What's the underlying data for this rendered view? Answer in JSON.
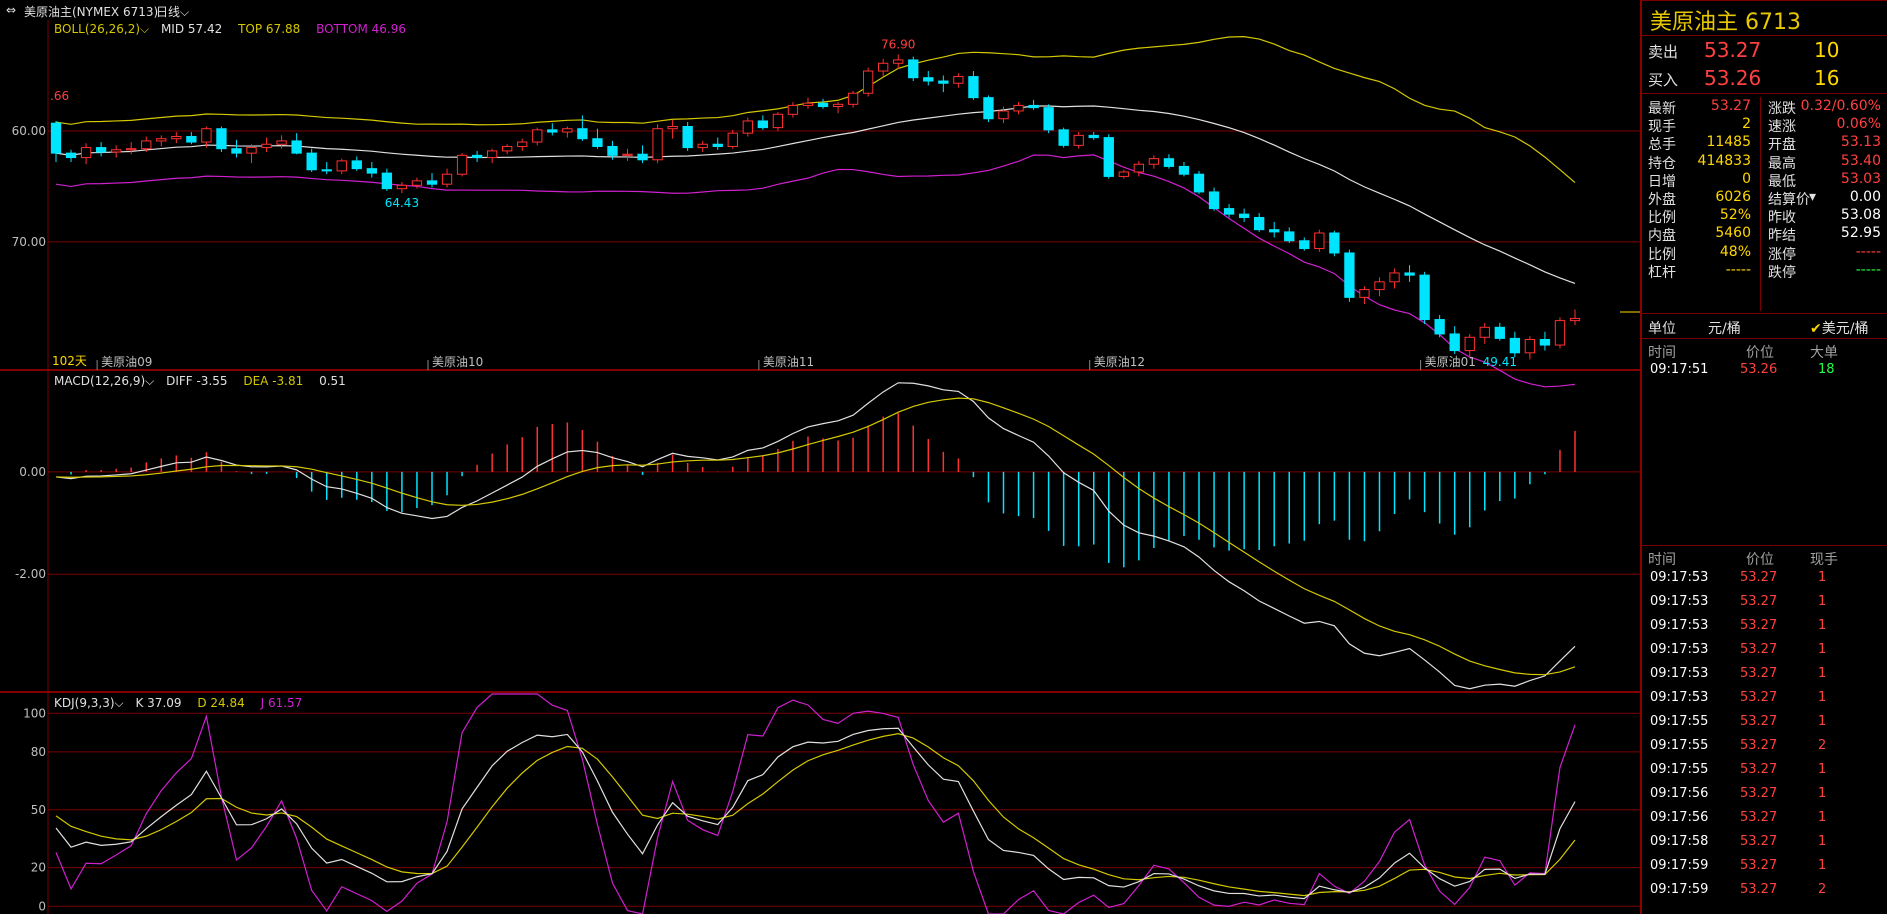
{
  "titlebar": {
    "instrument": "美原油主(NYMEX 6713)",
    "period": "日线"
  },
  "main": {
    "boll_label": "BOLL(26,26,2)",
    "boll_mid": "MID 57.42",
    "boll_top": "TOP 67.88",
    "boll_bottom": "BOTTOM 46.96",
    "price_ticks": [
      "70.00",
      "60.00"
    ],
    "left_price": ".66",
    "high_label": "76.90",
    "low_label_1": "64.43",
    "low_label_2": "49.41",
    "days_label": "102天",
    "months": [
      "美原油09",
      "美原油10",
      "美原油11",
      "美原油12",
      "美原油01"
    ]
  },
  "macd": {
    "label": "MACD(12,26,9)",
    "diff": "DIFF -3.55",
    "dea": "DEA -3.81",
    "macd": "0.51",
    "ticks": [
      "0.00",
      "-2.00"
    ]
  },
  "kdj": {
    "label": "KDJ(9,3,3)",
    "k": "K 37.09",
    "d": "D 24.84",
    "j": "J 61.57",
    "ticks": [
      "100",
      "80",
      "50",
      "20",
      "0"
    ]
  },
  "quote": {
    "title": "美原油主  6713",
    "sell_label": "卖出",
    "sell_price": "53.27",
    "sell_vol": "10",
    "buy_label": "买入",
    "buy_price": "53.26",
    "buy_vol": "16",
    "stats": [
      {
        "l1": "最新",
        "v1": "53.27",
        "c1": "red",
        "l2": "涨跌",
        "v2": "0.32/0.60%",
        "c2": "red"
      },
      {
        "l1": "现手",
        "v1": "2",
        "c1": "yel",
        "l2": "速涨",
        "v2": "0.06%",
        "c2": "red"
      },
      {
        "l1": "总手",
        "v1": "11485",
        "c1": "yel",
        "l2": "开盘",
        "v2": "53.13",
        "c2": "red"
      },
      {
        "l1": "持仓",
        "v1": "414833",
        "c1": "yel",
        "l2": "最高",
        "v2": "53.40",
        "c2": "red"
      },
      {
        "l1": "日增",
        "v1": "0",
        "c1": "yel",
        "l2": "最低",
        "v2": "53.03",
        "c2": "red"
      },
      {
        "l1": "外盘",
        "v1": "6026",
        "c1": "yel",
        "l2": "结算价",
        "v2": "0.00",
        "c2": "wht"
      },
      {
        "l1": "比例",
        "v1": "52%",
        "c1": "yel",
        "l2": "昨收",
        "v2": "53.08",
        "c2": "wht"
      },
      {
        "l1": "内盘",
        "v1": "5460",
        "c1": "yel",
        "l2": "昨结",
        "v2": "52.95",
        "c2": "wht"
      },
      {
        "l1": "比例",
        "v1": "48%",
        "c1": "yel",
        "l2": "涨停",
        "v2": "-----",
        "c2": "red"
      },
      {
        "l1": "杠杆",
        "v1": "-----",
        "c1": "yel",
        "l2": "跌停",
        "v2": "-----",
        "c2": "grn"
      }
    ],
    "unit_label": "单位",
    "unit_value": "元/桶",
    "unit_alt": "美元/桶",
    "big_headers": [
      "时间",
      "价位",
      "大单"
    ],
    "big_rows": [
      {
        "time": "09:17:51",
        "price": "53.26",
        "vol": "18"
      }
    ],
    "tick_headers": [
      "时间",
      "价位",
      "现手"
    ],
    "tick_rows": [
      {
        "time": "09:17:53",
        "price": "53.27",
        "vol": "1"
      },
      {
        "time": "09:17:53",
        "price": "53.27",
        "vol": "1"
      },
      {
        "time": "09:17:53",
        "price": "53.27",
        "vol": "1"
      },
      {
        "time": "09:17:53",
        "price": "53.27",
        "vol": "1"
      },
      {
        "time": "09:17:53",
        "price": "53.27",
        "vol": "1"
      },
      {
        "time": "09:17:53",
        "price": "53.27",
        "vol": "1"
      },
      {
        "time": "09:17:55",
        "price": "53.27",
        "vol": "1"
      },
      {
        "time": "09:17:55",
        "price": "53.27",
        "vol": "2"
      },
      {
        "time": "09:17:55",
        "price": "53.27",
        "vol": "1"
      },
      {
        "time": "09:17:56",
        "price": "53.27",
        "vol": "1"
      },
      {
        "time": "09:17:56",
        "price": "53.27",
        "vol": "1"
      },
      {
        "time": "09:17:58",
        "price": "53.27",
        "vol": "1"
      },
      {
        "time": "09:17:59",
        "price": "53.27",
        "vol": "1"
      },
      {
        "time": "09:17:59",
        "price": "53.27",
        "vol": "2"
      }
    ]
  },
  "colors": {
    "up": "#ff3030",
    "down": "#00e5ff",
    "mid": "#e0e0e0",
    "top": "#d4c800",
    "bottom": "#d020d0",
    "grid": "#7a0000"
  },
  "chart_data": {
    "type": "candlestick",
    "candles": [
      [
        70.7,
        70.9,
        67.2,
        68.0
      ],
      [
        68.0,
        68.3,
        67.2,
        67.6
      ],
      [
        67.6,
        68.9,
        67.0,
        68.5
      ],
      [
        68.5,
        69.0,
        67.7,
        68.1
      ],
      [
        68.1,
        68.7,
        67.6,
        68.3
      ],
      [
        68.3,
        69.0,
        67.9,
        68.4
      ],
      [
        68.4,
        69.5,
        68.1,
        69.1
      ],
      [
        69.1,
        69.6,
        68.6,
        69.3
      ],
      [
        69.3,
        69.9,
        68.9,
        69.5
      ],
      [
        69.5,
        69.9,
        68.8,
        69.0
      ],
      [
        69.0,
        70.4,
        68.5,
        70.2
      ],
      [
        70.2,
        70.4,
        68.1,
        68.4
      ],
      [
        68.4,
        69.2,
        67.6,
        68.0
      ],
      [
        68.0,
        68.8,
        67.1,
        68.5
      ],
      [
        68.5,
        69.4,
        68.1,
        68.8
      ],
      [
        68.8,
        69.6,
        68.4,
        69.1
      ],
      [
        69.1,
        69.8,
        67.9,
        68.0
      ],
      [
        68.0,
        68.4,
        66.3,
        66.5
      ],
      [
        66.5,
        67.2,
        66.1,
        66.4
      ],
      [
        66.4,
        67.5,
        66.1,
        67.3
      ],
      [
        67.3,
        67.7,
        66.4,
        66.6
      ],
      [
        66.6,
        67.2,
        65.8,
        66.2
      ],
      [
        66.2,
        66.6,
        64.6,
        64.8
      ],
      [
        64.8,
        65.4,
        64.4,
        65.1
      ],
      [
        65.1,
        65.8,
        64.8,
        65.5
      ],
      [
        65.5,
        66.2,
        64.9,
        65.2
      ],
      [
        65.2,
        66.6,
        64.9,
        66.1
      ],
      [
        66.1,
        68.0,
        65.9,
        67.8
      ],
      [
        67.8,
        68.2,
        67.2,
        67.6
      ],
      [
        67.6,
        68.4,
        67.1,
        68.2
      ],
      [
        68.2,
        68.8,
        67.9,
        68.6
      ],
      [
        68.6,
        69.3,
        68.2,
        69.0
      ],
      [
        69.0,
        70.3,
        68.7,
        70.1
      ],
      [
        70.1,
        70.7,
        69.6,
        69.9
      ],
      [
        69.9,
        70.4,
        69.4,
        70.2
      ],
      [
        70.2,
        71.4,
        69.1,
        69.3
      ],
      [
        69.3,
        70.2,
        68.4,
        68.6
      ],
      [
        68.6,
        69.1,
        67.4,
        67.8
      ],
      [
        67.8,
        68.4,
        67.3,
        67.9
      ],
      [
        67.9,
        68.7,
        67.1,
        67.4
      ],
      [
        67.4,
        70.6,
        67.1,
        70.2
      ],
      [
        70.2,
        71.0,
        69.3,
        70.4
      ],
      [
        70.4,
        70.8,
        68.2,
        68.5
      ],
      [
        68.5,
        69.1,
        68.1,
        68.8
      ],
      [
        68.8,
        69.4,
        68.3,
        68.6
      ],
      [
        68.6,
        70.1,
        68.4,
        69.8
      ],
      [
        69.8,
        71.2,
        69.5,
        70.9
      ],
      [
        70.9,
        71.4,
        70.1,
        70.3
      ],
      [
        70.3,
        71.7,
        70.0,
        71.5
      ],
      [
        71.5,
        72.6,
        71.2,
        72.3
      ],
      [
        72.3,
        73.0,
        72.0,
        72.5
      ],
      [
        72.5,
        72.9,
        72.0,
        72.2
      ],
      [
        72.2,
        72.6,
        71.6,
        72.4
      ],
      [
        72.4,
        73.6,
        72.1,
        73.4
      ],
      [
        73.4,
        75.7,
        73.1,
        75.4
      ],
      [
        75.4,
        76.5,
        74.9,
        76.1
      ],
      [
        76.1,
        76.9,
        75.6,
        76.4
      ],
      [
        76.4,
        76.7,
        74.5,
        74.8
      ],
      [
        74.8,
        75.4,
        74.1,
        74.5
      ],
      [
        74.5,
        75.0,
        73.5,
        74.3
      ],
      [
        74.3,
        75.2,
        73.9,
        74.9
      ],
      [
        74.9,
        75.4,
        72.8,
        73.0
      ],
      [
        73.0,
        73.2,
        70.8,
        71.1
      ],
      [
        71.1,
        72.2,
        70.7,
        71.8
      ],
      [
        71.8,
        72.6,
        71.5,
        72.3
      ],
      [
        72.3,
        72.8,
        71.9,
        72.1
      ],
      [
        72.1,
        72.4,
        69.8,
        70.1
      ],
      [
        70.1,
        70.3,
        68.5,
        68.7
      ],
      [
        68.7,
        69.9,
        68.4,
        69.6
      ],
      [
        69.6,
        69.9,
        69.2,
        69.4
      ],
      [
        69.4,
        69.7,
        65.7,
        65.9
      ],
      [
        65.9,
        66.5,
        65.7,
        66.3
      ],
      [
        66.3,
        67.3,
        65.9,
        67.0
      ],
      [
        67.0,
        67.8,
        66.6,
        67.5
      ],
      [
        67.5,
        67.9,
        66.6,
        66.8
      ],
      [
        66.8,
        67.2,
        65.9,
        66.1
      ],
      [
        66.1,
        66.4,
        64.3,
        64.5
      ],
      [
        64.5,
        64.9,
        62.8,
        63.0
      ],
      [
        63.0,
        63.4,
        62.2,
        62.5
      ],
      [
        62.5,
        63.0,
        61.8,
        62.2
      ],
      [
        62.2,
        62.6,
        60.9,
        61.1
      ],
      [
        61.1,
        61.8,
        60.4,
        60.9
      ],
      [
        60.9,
        61.3,
        59.9,
        60.1
      ],
      [
        60.1,
        60.4,
        59.2,
        59.4
      ],
      [
        59.4,
        61.1,
        59.1,
        60.8
      ],
      [
        60.8,
        61.0,
        58.7,
        59.0
      ],
      [
        59.0,
        59.3,
        54.6,
        55.0
      ],
      [
        55.0,
        56.0,
        54.4,
        55.7
      ],
      [
        55.7,
        56.8,
        55.1,
        56.4
      ],
      [
        56.4,
        57.6,
        55.8,
        57.2
      ],
      [
        57.2,
        57.9,
        56.4,
        57.0
      ],
      [
        57.0,
        57.3,
        52.6,
        53.0
      ],
      [
        53.0,
        53.4,
        51.4,
        51.7
      ],
      [
        51.7,
        52.4,
        49.9,
        50.2
      ],
      [
        50.2,
        51.7,
        49.7,
        51.4
      ],
      [
        51.4,
        52.7,
        50.8,
        52.3
      ],
      [
        52.3,
        52.7,
        51.1,
        51.3
      ],
      [
        51.3,
        51.9,
        49.6,
        50.0
      ],
      [
        50.0,
        51.5,
        49.4,
        51.2
      ],
      [
        51.2,
        51.9,
        50.2,
        50.7
      ],
      [
        50.7,
        53.2,
        50.4,
        52.9
      ],
      [
        52.9,
        53.9,
        52.5,
        53.1
      ]
    ],
    "ylim": [
      48,
      80
    ],
    "y_ticks": [
      60,
      70
    ],
    "macd_ylim": [
      -4.3,
      1.95
    ],
    "kdj_ylim": [
      -4,
      110
    ]
  }
}
